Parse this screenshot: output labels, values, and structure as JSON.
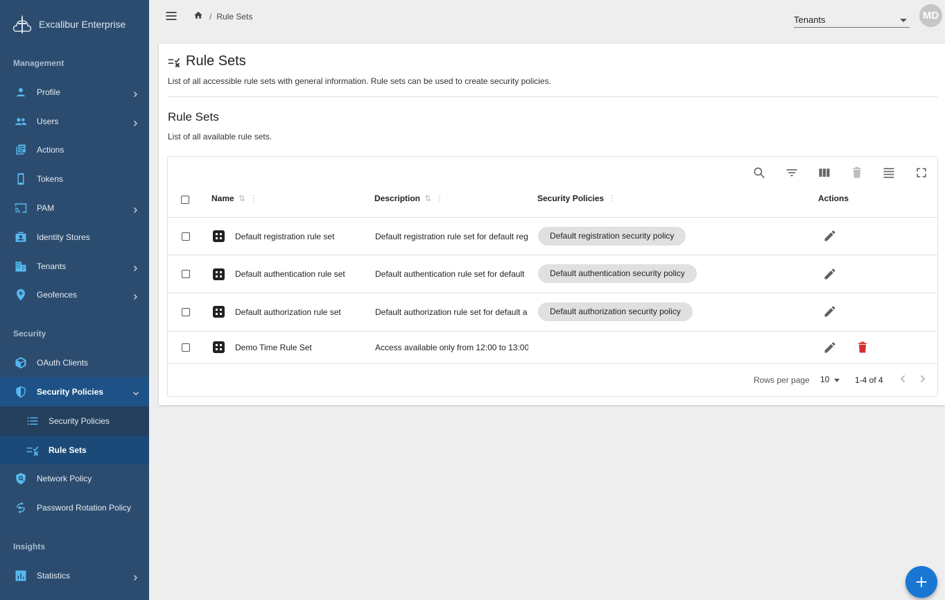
{
  "brand": {
    "name": "Excalibur Enterprise"
  },
  "sidebar": {
    "sections": [
      {
        "title": "Management"
      },
      {
        "title": "Security"
      },
      {
        "title": "Insights"
      }
    ],
    "management_items": [
      {
        "label": "Profile",
        "icon": "person-icon",
        "expandable": true
      },
      {
        "label": "Users",
        "icon": "users-icon",
        "expandable": true
      },
      {
        "label": "Actions",
        "icon": "actions-icon",
        "expandable": false
      },
      {
        "label": "Tokens",
        "icon": "phone-icon",
        "expandable": false
      },
      {
        "label": "PAM",
        "icon": "cast-icon",
        "expandable": true
      },
      {
        "label": "Identity Stores",
        "icon": "contact-card-icon",
        "expandable": false
      },
      {
        "label": "Tenants",
        "icon": "building-icon",
        "expandable": true
      },
      {
        "label": "Geofences",
        "icon": "location-pin-icon",
        "expandable": true
      }
    ],
    "security_items": [
      {
        "label": "OAuth Clients",
        "icon": "cube-icon"
      },
      {
        "label": "Security Policies",
        "icon": "shield-icon"
      },
      {
        "label": "Security Policies",
        "icon": "list-icon"
      },
      {
        "label": "Rule Sets",
        "icon": "rule-icon"
      },
      {
        "label": "Network Policy",
        "icon": "network-shield-icon"
      },
      {
        "label": "Password Rotation Policy",
        "icon": "key-rotate-icon"
      }
    ],
    "insights_items": [
      {
        "label": "Statistics",
        "icon": "chart-icon"
      }
    ]
  },
  "topbar": {
    "breadcrumb_current": "Rule Sets",
    "breadcrumb_separator": "/",
    "tenant_select_value": "Tenants",
    "avatar_initials": "MD"
  },
  "page": {
    "title": "Rule Sets",
    "description": "List of all accessible rule sets with general information. Rule sets can be used to create security policies.",
    "section_title": "Rule Sets",
    "section_description": "List of all available rule sets."
  },
  "table": {
    "columns": {
      "name": "Name",
      "description": "Description",
      "security_policies": "Security Policies",
      "actions": "Actions"
    },
    "rows": [
      {
        "name": "Default registration rule set",
        "description": "Default registration rule set for default reg",
        "policy": "Default registration security policy"
      },
      {
        "name": "Default authentication rule set",
        "description": "Default authentication rule set for default",
        "policy": "Default authentication security policy"
      },
      {
        "name": "Default authorization rule set",
        "description": "Default authorization rule set for default a",
        "policy": "Default authorization security policy"
      },
      {
        "name": "Demo Time Rule Set",
        "description": "Access available only from 12:00 to 13:00",
        "policy": ""
      }
    ],
    "footer": {
      "rows_per_page_label": "Rows per page",
      "rows_per_page_value": "10",
      "range": "1-4 of 4"
    }
  },
  "colors": {
    "sidebar_bg": "#2b4c6f",
    "active_item_bg": "#1e5287",
    "icon_accent": "#57b8ef",
    "fab": "#1976d2",
    "delete": "#d32f2f"
  }
}
